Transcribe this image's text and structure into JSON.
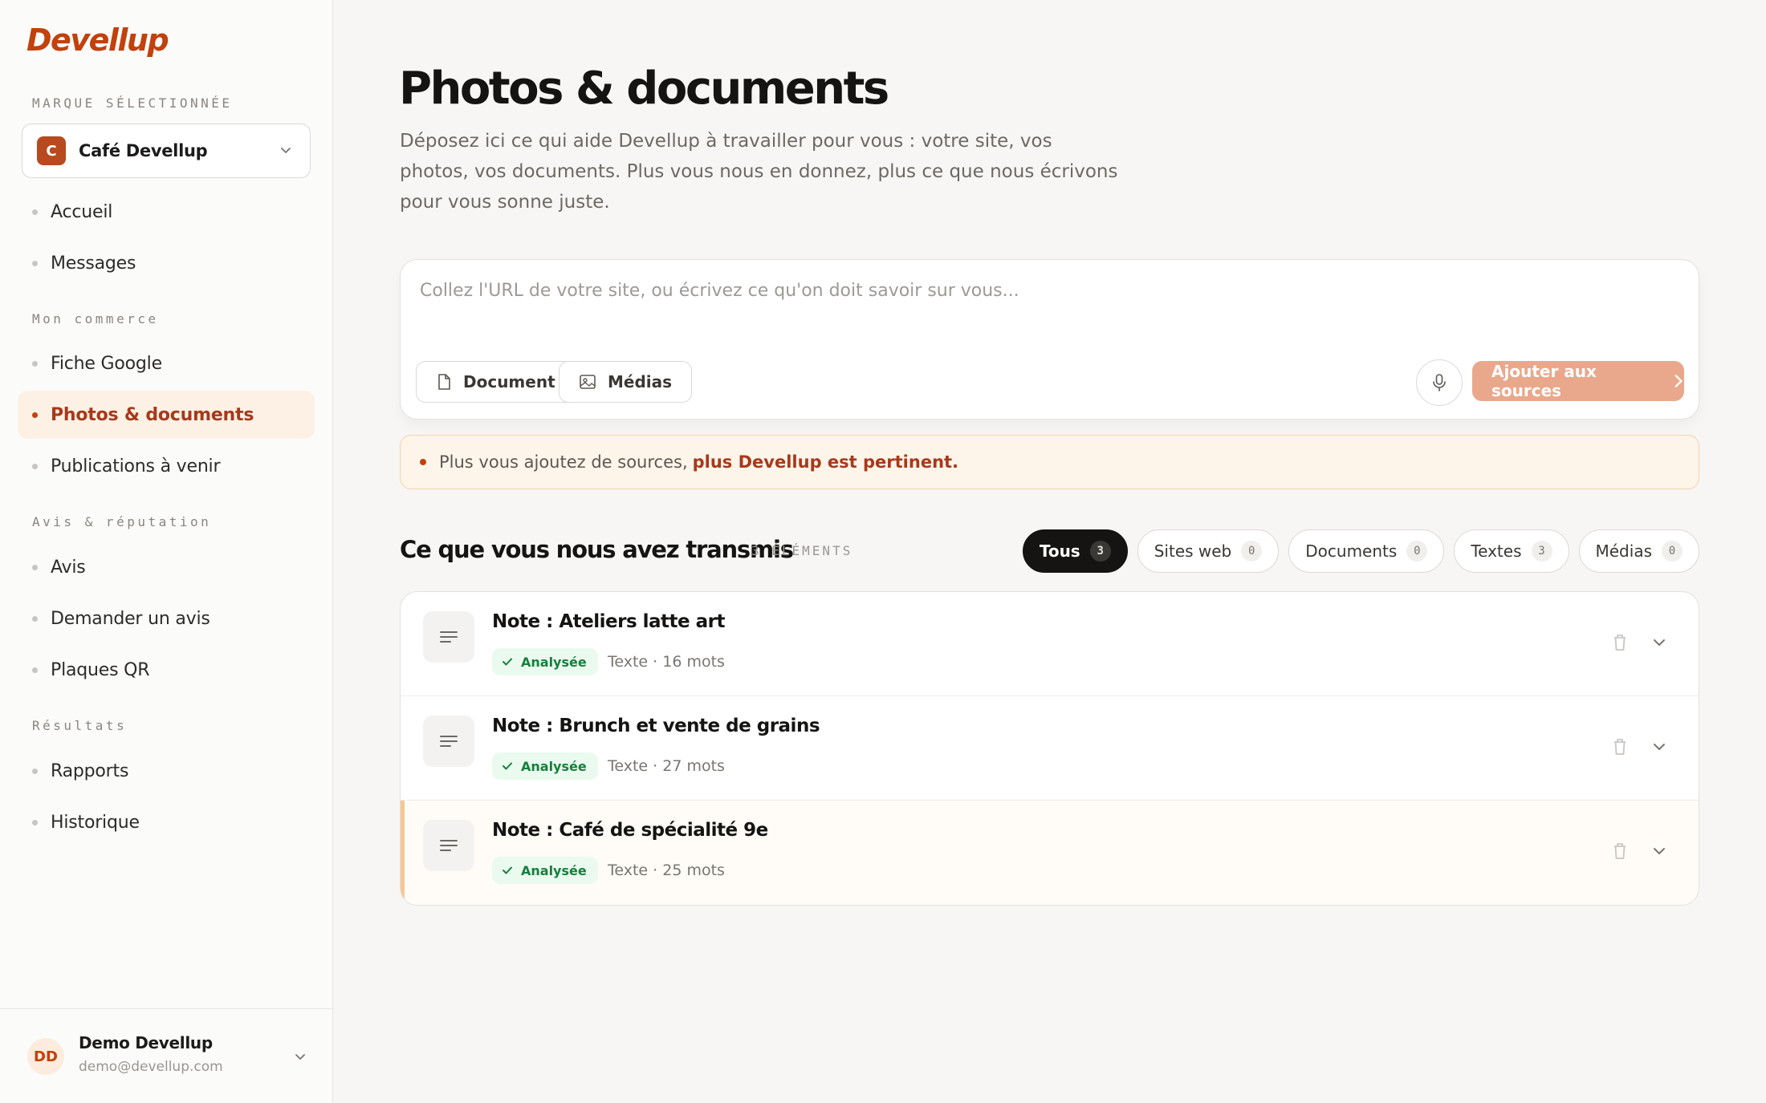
{
  "app": {
    "logo": "Devellup",
    "accent": "#c2410c"
  },
  "sidebar": {
    "brand_label": "MARQUE SÉLECTIONNÉE",
    "brand": {
      "initial": "C",
      "name": "Café Devellup"
    },
    "top_items": [
      {
        "label": "Accueil"
      },
      {
        "label": "Messages"
      }
    ],
    "sections": [
      {
        "label": "Mon commerce",
        "items": [
          {
            "label": "Fiche Google"
          },
          {
            "label": "Photos & documents"
          },
          {
            "label": "Publications à venir"
          }
        ]
      },
      {
        "label": "Avis & réputation",
        "items": [
          {
            "label": "Avis"
          },
          {
            "label": "Demander un avis"
          },
          {
            "label": "Plaques QR"
          }
        ]
      },
      {
        "label": "Résultats",
        "items": [
          {
            "label": "Rapports"
          },
          {
            "label": "Historique"
          }
        ]
      }
    ],
    "user": {
      "initials": "DD",
      "name": "Demo Devellup",
      "email": "demo@devellup.com"
    }
  },
  "main": {
    "title": "Photos & documents",
    "description": "Déposez ici ce qui aide Devellup à travailler pour vous : votre site, vos photos, vos documents. Plus vous nous en donnez, plus ce que nous écrivons pour vous sonne juste.",
    "composer": {
      "placeholder": "Collez l'URL de votre site, ou écrivez ce qu'on doit savoir sur vous...",
      "value": "",
      "document_label": "Document",
      "media_label": "Médias",
      "submit_label": "Ajouter aux sources"
    },
    "tip": {
      "text": "Plus vous ajoutez de sources,",
      "highlight": "plus Devellup est pertinent."
    },
    "list": {
      "title": "Ce que vous nous avez transmis",
      "count": "3 ÉLÉMENTS",
      "filters": [
        {
          "label": "Tous",
          "count": "3",
          "active": true
        },
        {
          "label": "Sites web",
          "count": "0"
        },
        {
          "label": "Documents",
          "count": "0"
        },
        {
          "label": "Textes",
          "count": "3"
        },
        {
          "label": "Médias",
          "count": "0"
        }
      ],
      "items": [
        {
          "title": "Note : Ateliers latte art",
          "status": "Analysée",
          "meta": "Texte · 16 mots"
        },
        {
          "title": "Note : Brunch et vente de grains",
          "status": "Analysée",
          "meta": "Texte · 27 mots"
        },
        {
          "title": "Note : Café de spécialité 9e",
          "status": "Analysée",
          "meta": "Texte · 25 mots"
        }
      ]
    }
  }
}
